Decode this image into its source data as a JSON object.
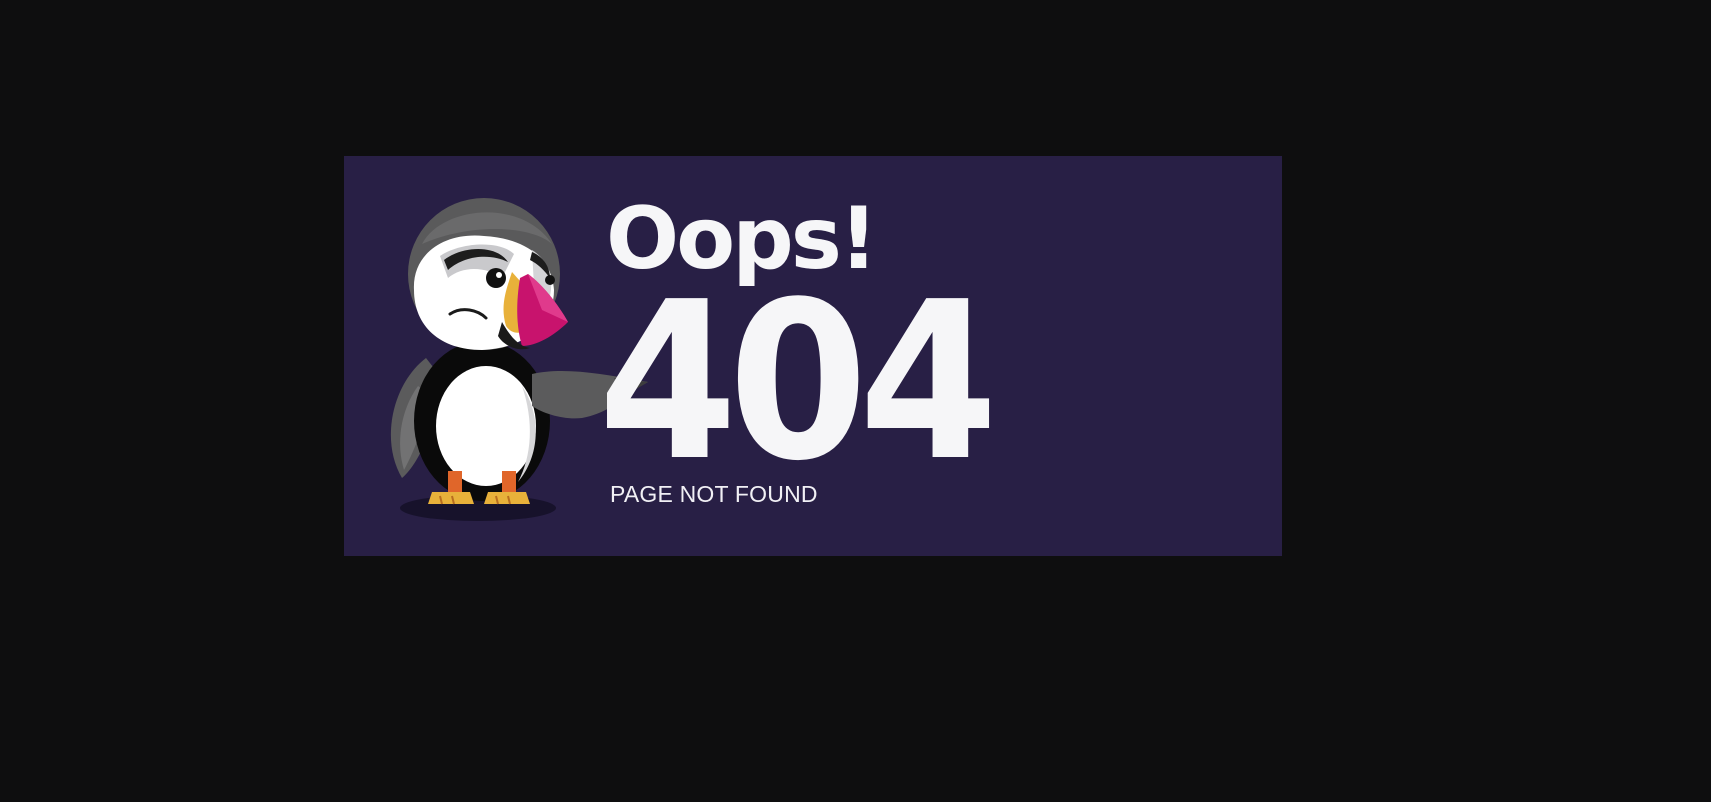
{
  "page": {
    "headline": "Oops!",
    "error_code": "404",
    "message": "PAGE NOT FOUND"
  },
  "illustration": {
    "subject": "puffin-mascot",
    "colors": {
      "banner_background": "#281f45",
      "page_background": "#0e0e0f",
      "beak": "#c8136d",
      "beak_accent": "#e8b13a",
      "feet": "#e8772e"
    }
  }
}
